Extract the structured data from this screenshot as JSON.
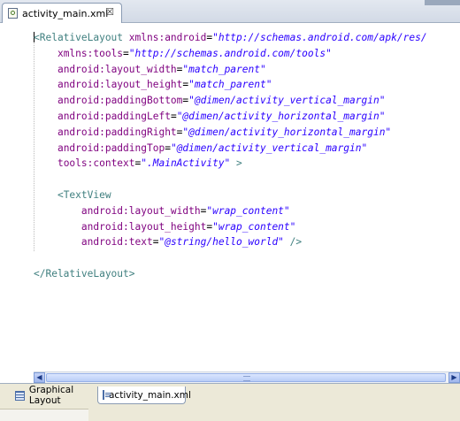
{
  "editor": {
    "tab_label": "activity_main.xml",
    "tab_icon": "xml-file-icon",
    "close_glyph": "☒"
  },
  "code_lines": [
    [
      {
        "c": "t",
        "s": "<RelativeLayout "
      },
      {
        "c": "a",
        "s": "xmlns:android"
      },
      {
        "c": "p",
        "s": "="
      },
      {
        "c": "v",
        "s": "\"http://schemas.android.com/apk/res/"
      }
    ],
    [
      {
        "c": "p",
        "s": "    "
      },
      {
        "c": "a",
        "s": "xmlns:tools"
      },
      {
        "c": "p",
        "s": "="
      },
      {
        "c": "v",
        "s": "\"http://schemas.android.com/tools\""
      }
    ],
    [
      {
        "c": "p",
        "s": "    "
      },
      {
        "c": "a",
        "s": "android:layout_width"
      },
      {
        "c": "p",
        "s": "="
      },
      {
        "c": "v",
        "s": "\"match_parent\""
      }
    ],
    [
      {
        "c": "p",
        "s": "    "
      },
      {
        "c": "a",
        "s": "android:layout_height"
      },
      {
        "c": "p",
        "s": "="
      },
      {
        "c": "v",
        "s": "\"match_parent\""
      }
    ],
    [
      {
        "c": "p",
        "s": "    "
      },
      {
        "c": "a",
        "s": "android:paddingBottom"
      },
      {
        "c": "p",
        "s": "="
      },
      {
        "c": "v",
        "s": "\"@dimen/activity_vertical_margin\""
      }
    ],
    [
      {
        "c": "p",
        "s": "    "
      },
      {
        "c": "a",
        "s": "android:paddingLeft"
      },
      {
        "c": "p",
        "s": "="
      },
      {
        "c": "v",
        "s": "\"@dimen/activity_horizontal_margin\""
      }
    ],
    [
      {
        "c": "p",
        "s": "    "
      },
      {
        "c": "a",
        "s": "android:paddingRight"
      },
      {
        "c": "p",
        "s": "="
      },
      {
        "c": "v",
        "s": "\"@dimen/activity_horizontal_margin\""
      }
    ],
    [
      {
        "c": "p",
        "s": "    "
      },
      {
        "c": "a",
        "s": "android:paddingTop"
      },
      {
        "c": "p",
        "s": "="
      },
      {
        "c": "v",
        "s": "\"@dimen/activity_vertical_margin\""
      }
    ],
    [
      {
        "c": "p",
        "s": "    "
      },
      {
        "c": "a",
        "s": "tools:context"
      },
      {
        "c": "p",
        "s": "="
      },
      {
        "c": "v",
        "s": "\".MainActivity\""
      },
      {
        "c": "t",
        "s": " >"
      }
    ],
    [
      {
        "c": "p",
        "s": ""
      }
    ],
    [
      {
        "c": "p",
        "s": "    "
      },
      {
        "c": "t",
        "s": "<TextView"
      }
    ],
    [
      {
        "c": "p",
        "s": "        "
      },
      {
        "c": "a",
        "s": "android:layout_width"
      },
      {
        "c": "p",
        "s": "="
      },
      {
        "c": "v",
        "s": "\"wrap_content\""
      }
    ],
    [
      {
        "c": "p",
        "s": "        "
      },
      {
        "c": "a",
        "s": "android:layout_height"
      },
      {
        "c": "p",
        "s": "="
      },
      {
        "c": "v",
        "s": "\"wrap_content\""
      }
    ],
    [
      {
        "c": "p",
        "s": "        "
      },
      {
        "c": "a",
        "s": "android:text"
      },
      {
        "c": "p",
        "s": "="
      },
      {
        "c": "v",
        "s": "\"@string/hello_world\""
      },
      {
        "c": "t",
        "s": " />"
      }
    ],
    [
      {
        "c": "p",
        "s": ""
      }
    ],
    [
      {
        "c": "t",
        "s": "</RelativeLayout>"
      }
    ]
  ],
  "bottom_tabs": [
    {
      "label": "Graphical Layout",
      "icon": "layout-icon",
      "selected": false
    },
    {
      "label": "activity_main.xml",
      "icon": "xml-source-icon",
      "selected": true
    }
  ],
  "scrollbar": {
    "left_arrow": "◀",
    "right_arrow": "▶"
  },
  "colors": {
    "tag": "#3f7f7f",
    "attribute": "#7f007f",
    "value": "#2a00ff"
  }
}
